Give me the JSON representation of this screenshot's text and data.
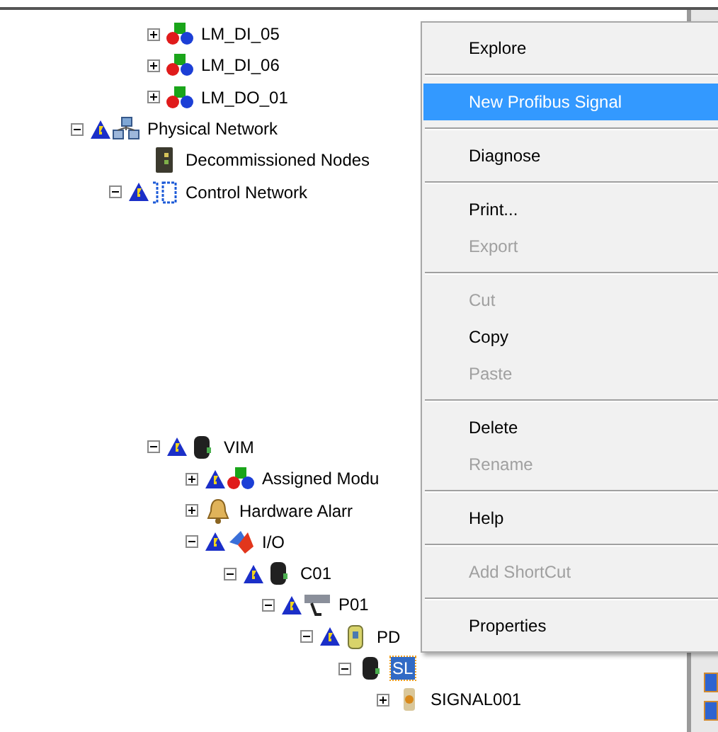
{
  "tree_top": [
    {
      "label": "LM_DI_05",
      "kind": "module",
      "warning": false,
      "expanded": false,
      "selected": false
    },
    {
      "label": "LM_DI_06",
      "kind": "module",
      "warning": false,
      "expanded": false,
      "selected": false
    },
    {
      "label": "LM_DO_01",
      "kind": "module",
      "warning": false,
      "expanded": false,
      "selected": false
    }
  ],
  "tree": [
    {
      "label": "Physical Network",
      "kind": "network",
      "warning": true,
      "expanded": true,
      "selected": false,
      "children": [
        {
          "label": "Decommissioned Nodes",
          "kind": "nodes",
          "warning": false,
          "selected": false
        },
        {
          "label": "Control Network",
          "kind": "control",
          "warning": true,
          "expanded": true,
          "selected": false,
          "children": [
            {
              "label": "VIM",
              "kind": "device",
              "warning": true,
              "expanded": true,
              "selected": false,
              "children": [
                {
                  "label": "Assigned Modu",
                  "kind": "module",
                  "warning": true,
                  "expanded": false,
                  "selected": false
                },
                {
                  "label": "Hardware Alarr",
                  "kind": "alarm",
                  "warning": false,
                  "expanded": false,
                  "selected": false
                },
                {
                  "label": "I/O",
                  "kind": "io",
                  "warning": true,
                  "expanded": true,
                  "selected": false,
                  "children": [
                    {
                      "label": "C01",
                      "kind": "device",
                      "warning": true,
                      "expanded": true,
                      "selected": false,
                      "children": [
                        {
                          "label": "P01",
                          "kind": "bus",
                          "warning": true,
                          "expanded": true,
                          "selected": false,
                          "children": [
                            {
                              "label": "PD",
                              "kind": "pd",
                              "warning": true,
                              "expanded": true,
                              "selected": false,
                              "children": [
                                {
                                  "label": "SL",
                                  "kind": "device",
                                  "warning": false,
                                  "expanded": true,
                                  "selected": true,
                                  "children": [
                                    {
                                      "label": "SIGNAL001",
                                      "kind": "signal",
                                      "warning": false,
                                      "expanded": false,
                                      "selected": false
                                    }
                                  ]
                                }
                              ]
                            }
                          ]
                        }
                      ]
                    }
                  ]
                }
              ]
            }
          ]
        }
      ]
    }
  ],
  "context_menu": [
    {
      "kind": "item",
      "label": "Explore",
      "disabled": false,
      "selected": false
    },
    {
      "kind": "separator"
    },
    {
      "kind": "item",
      "label": "New Profibus Signal",
      "disabled": false,
      "selected": true
    },
    {
      "kind": "separator"
    },
    {
      "kind": "item",
      "label": "Diagnose",
      "disabled": false,
      "selected": false
    },
    {
      "kind": "separator"
    },
    {
      "kind": "item",
      "label": "Print...",
      "disabled": false,
      "selected": false
    },
    {
      "kind": "item",
      "label": "Export",
      "disabled": true,
      "selected": false
    },
    {
      "kind": "separator"
    },
    {
      "kind": "item",
      "label": "Cut",
      "disabled": true,
      "selected": false
    },
    {
      "kind": "item",
      "label": "Copy",
      "disabled": false,
      "selected": false
    },
    {
      "kind": "item",
      "label": "Paste",
      "disabled": true,
      "selected": false
    },
    {
      "kind": "separator"
    },
    {
      "kind": "item",
      "label": "Delete",
      "disabled": false,
      "selected": false
    },
    {
      "kind": "item",
      "label": "Rename",
      "disabled": true,
      "selected": false
    },
    {
      "kind": "separator"
    },
    {
      "kind": "item",
      "label": "Help",
      "disabled": false,
      "selected": false
    },
    {
      "kind": "separator"
    },
    {
      "kind": "item",
      "label": "Add ShortCut",
      "disabled": true,
      "selected": false
    },
    {
      "kind": "separator"
    },
    {
      "kind": "item",
      "label": "Properties",
      "disabled": false,
      "selected": false
    }
  ]
}
